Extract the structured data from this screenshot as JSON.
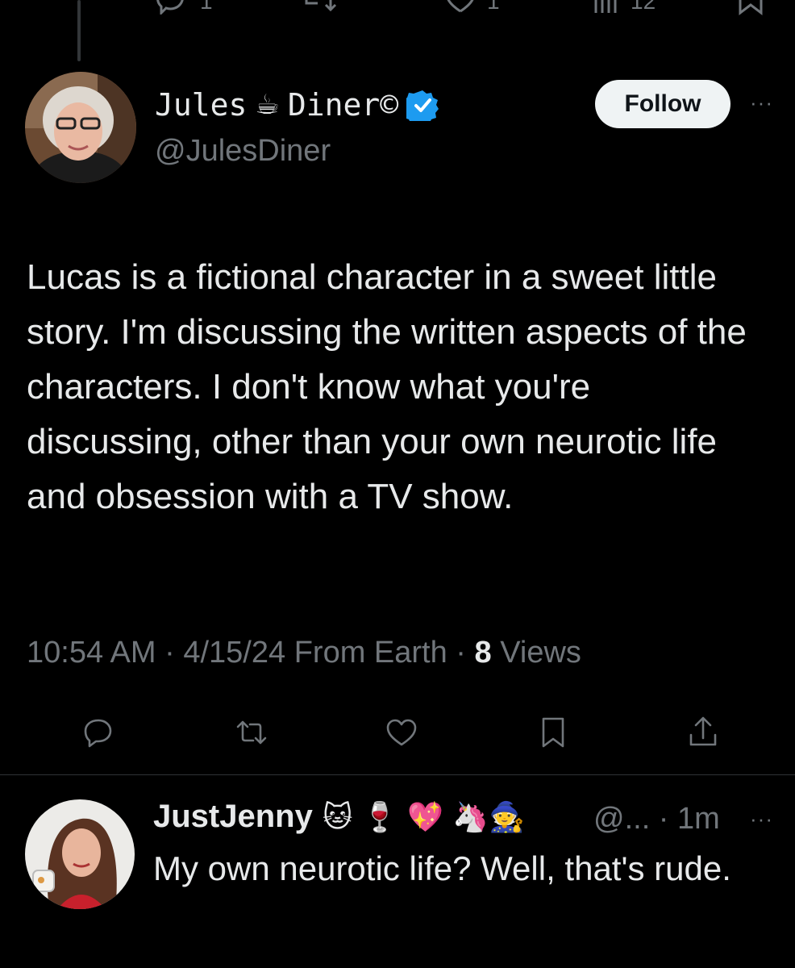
{
  "top_actions": {
    "reply_count": "1",
    "like_count": "1",
    "views_count": "12"
  },
  "tweet": {
    "author": {
      "name_left": "Jules",
      "name_emoji": "☕",
      "name_right": "Diner©",
      "handle": "@JulesDiner",
      "verified": true
    },
    "follow_label": "Follow",
    "more_label": "···",
    "text": "Lucas is a fictional character in a sweet little story. I'm discussing the written aspects of the characters. I don't know what you're discussing, other than your own neurotic life and obsession with a TV show.",
    "meta": {
      "time": "10:54 AM",
      "sep1": " · ",
      "date": "4/15/24",
      "source": " From Earth",
      "sep2": " · ",
      "views_count": "8",
      "views_label": " Views"
    },
    "actions": [
      "reply-icon",
      "retweet-icon",
      "like-icon",
      "bookmark-icon",
      "share-icon"
    ]
  },
  "reply": {
    "name": "JustJenny",
    "emojis": "🐱 🍷 💖 🦄🧙",
    "handle_time": "@... · 1m",
    "text": "My own neurotic life? Well, that's rude.",
    "more_label": "···"
  },
  "colors": {
    "background": "#000000",
    "text_primary": "#e7e9ea",
    "text_secondary": "#71767b",
    "verified_blue": "#1d9bf0",
    "divider": "#2f3336"
  }
}
